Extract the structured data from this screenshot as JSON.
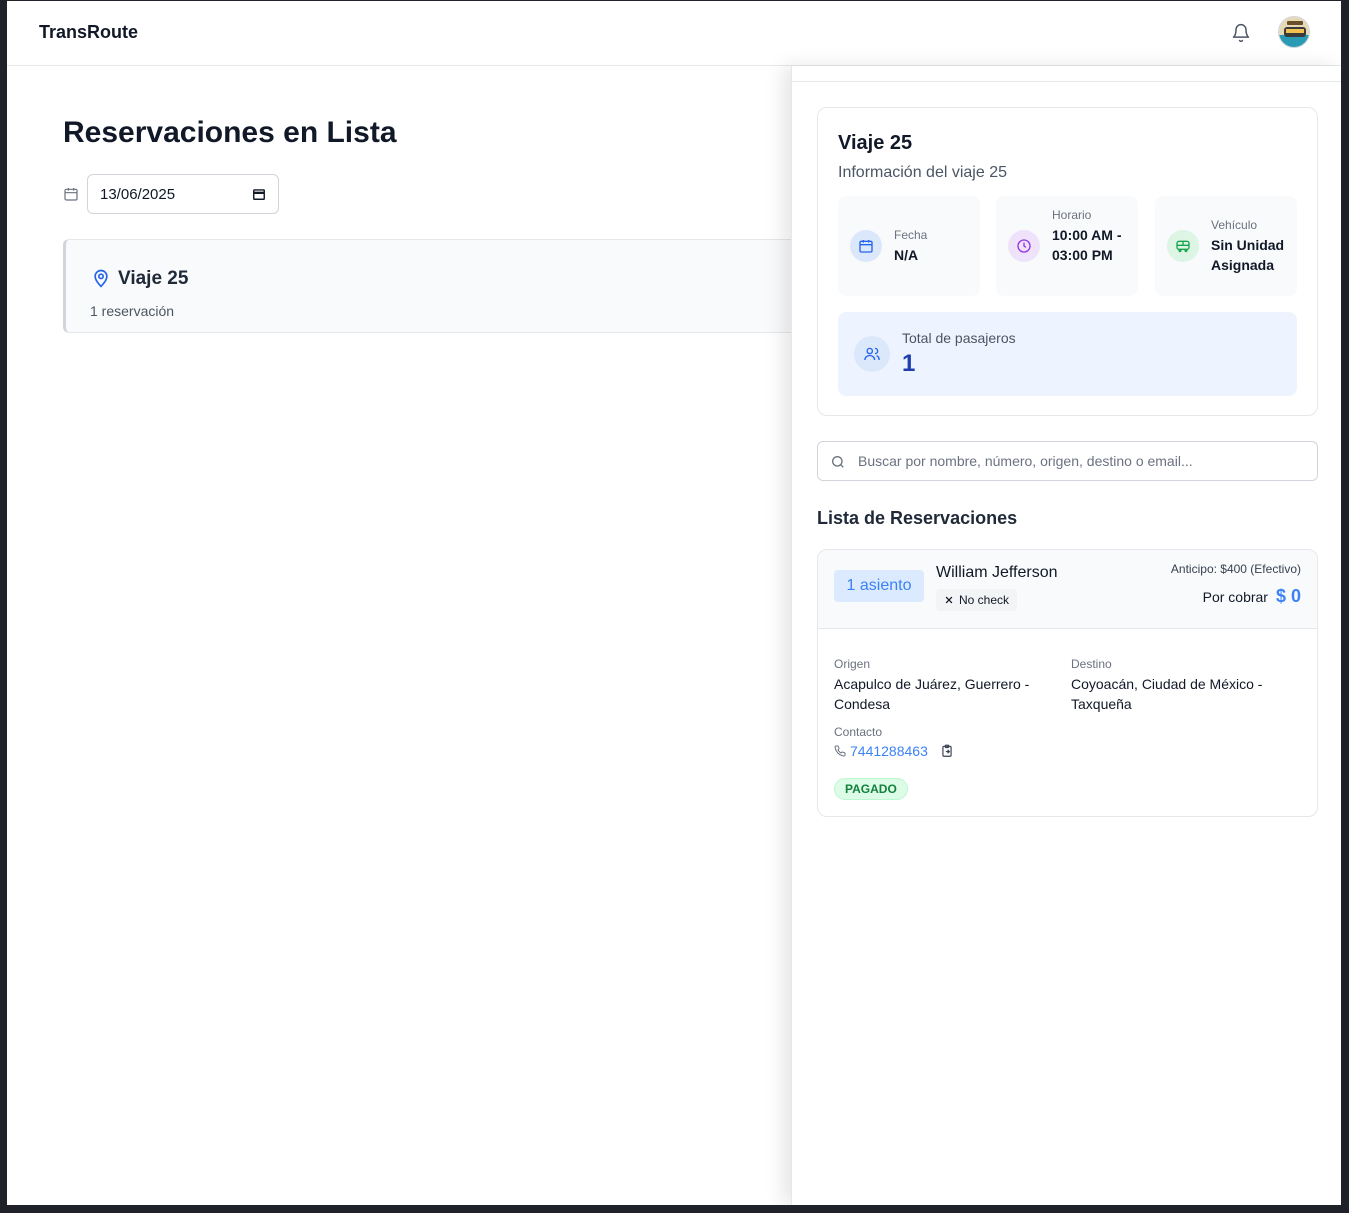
{
  "app": {
    "brand": "TransRoute"
  },
  "header": {
    "bell_icon": "bell-icon",
    "avatar_icon": "user-avatar"
  },
  "main": {
    "title": "Reservaciones en Lista",
    "date_value": "13/06/2025",
    "trip": {
      "name": "Viaje 25",
      "count": "1 reservación"
    }
  },
  "panel": {
    "info": {
      "title": "Viaje 25",
      "subtitle": "Información del viaje 25",
      "fecha_label": "Fecha",
      "fecha_value": "N/A",
      "horario_label": "Horario",
      "horario_value": "10:00 AM - 03:00 PM",
      "vehiculo_label": "Vehículo",
      "vehiculo_value": "Sin Unidad Asignada",
      "passengers_label": "Total de pasajeros",
      "passengers_value": "1"
    },
    "search": {
      "placeholder": "Buscar por nombre, número, origen, destino o email..."
    },
    "list_title": "Lista de Reservaciones",
    "reservations": [
      {
        "seats": "1 asiento",
        "name": "William Jefferson",
        "check_status": "No check",
        "anticipo": "Anticipo: $400 (Efectivo)",
        "por_cobrar_label": "Por cobrar",
        "por_cobrar_value": "$ 0",
        "origin_label": "Origen",
        "origin": "Acapulco de Juárez, Guerrero - Condesa",
        "dest_label": "Destino",
        "dest": "Coyoacán, Ciudad de México - Taxqueña",
        "contact_label": "Contacto",
        "phone": "7441288463",
        "payment_status": "PAGADO"
      }
    ]
  },
  "colors": {
    "accent": "#3b82f6",
    "paid_bg": "#dcfce7",
    "paid_text": "#15803d",
    "passenger_box": "#eef4ff"
  }
}
